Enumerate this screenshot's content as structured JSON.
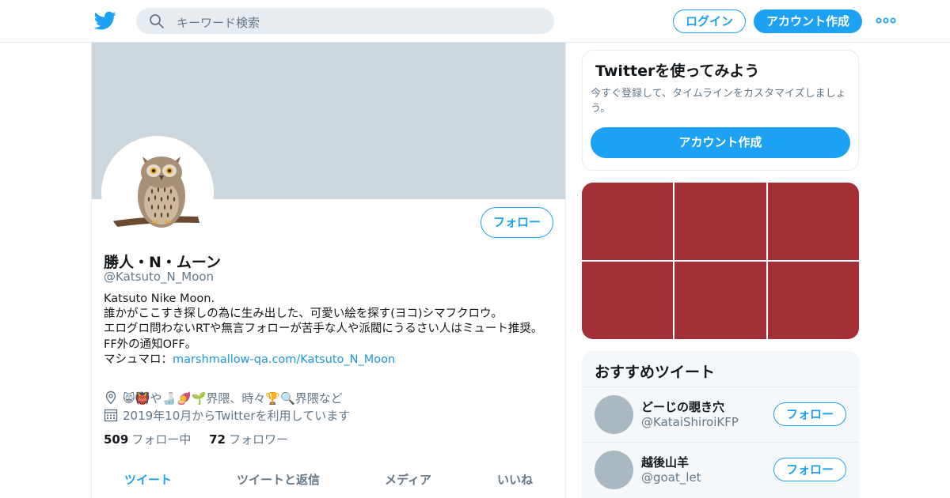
{
  "header": {
    "logo_icon": "twitter-bird-icon",
    "search_placeholder": "キーワード検索",
    "login_label": "ログイン",
    "signup_label": "アカウント作成",
    "more_icon": "more-dots-icon",
    "accent_color": "#1da1f2"
  },
  "profile": {
    "banner_color": "#ccd6dd",
    "avatar_icon": "owl-avatar-icon",
    "follow_label": "フォロー",
    "name": "勝人・N・ムーン",
    "handle": "@Katsuto_N_Moon",
    "bio_lines": [
      "Katsuto Nike Moon.",
      "誰かがここすき探しの為に生み出した、可愛い絵を探す(ヨコ)シマフクロウ。",
      "エログロ問わないRTや無言フォローが苦手な人や派閥にうるさい人はミュート推奨。",
      "FF外の通知OFF。"
    ],
    "marshmallow_prefix": "マシュマロ：",
    "marshmallow_link": "marshmallow-qa.com/Katsuto_N_Moon",
    "location": "😸👹や🍶🍠🌱界隈、時々🏆🔍界隈など",
    "location_icon": "location-pin-icon",
    "joined": "2019年10月からTwitterを利用しています",
    "joined_icon": "calendar-icon",
    "following_count": "509",
    "following_label": "フォロー中",
    "followers_count": "72",
    "followers_label": "フォロワー"
  },
  "tabs": [
    {
      "label": "ツイート",
      "active": true
    },
    {
      "label": "ツイートと返信",
      "active": false
    },
    {
      "label": "メディア",
      "active": false
    },
    {
      "label": "いいね",
      "active": false
    }
  ],
  "signup_card": {
    "title": "Twitterを使ってみよう",
    "description": "今すぐ登録して、タイムラインをカスタマイズしましょう。",
    "button_label": "アカウント作成"
  },
  "media_grid": {
    "tile_color": "#a33037",
    "tile_count": 6
  },
  "recommended": {
    "title": "おすすめツイート",
    "users": [
      {
        "name": "どーじの覗き穴",
        "handle": "@KataiShiroiKFP",
        "follow_label": "フォロー"
      },
      {
        "name": "越後山羊",
        "handle": "@goat_let",
        "follow_label": "フォロー"
      }
    ]
  }
}
